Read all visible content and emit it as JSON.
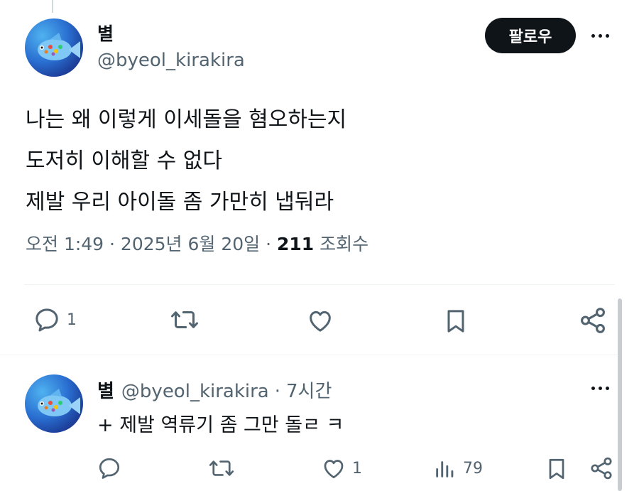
{
  "tweet": {
    "author_name": "별",
    "author_handle": "@byeol_kirakira",
    "follow_label": "팔로우",
    "text_lines": [
      "나는 왜 이렇게 이세돌을 혐오하는지",
      "도저히 이해할 수 없다",
      "제발 우리 아이돌 좀 가만히 냅둬라"
    ],
    "meta": {
      "time_date": "오전 1:49 · 2025년 6월 20일",
      "separator": " · ",
      "views_count": "211",
      "views_label": " 조회수"
    },
    "actions": {
      "reply_count": "1"
    }
  },
  "reply": {
    "author_name": "별",
    "author_handle": "@byeol_kirakira",
    "dot": "·",
    "time": "7시간",
    "text": "+ 제발 역류기 좀 그만 돌ㄹ ㅋ",
    "actions": {
      "like_count": "1",
      "views_count": "79"
    }
  },
  "icons": [
    "more-icon",
    "reply-icon",
    "retweet-icon",
    "like-icon",
    "bookmark-icon",
    "share-icon",
    "views-icon"
  ],
  "colors": {
    "text": "#0f1419",
    "secondary": "#536471",
    "follow_bg": "#0f1419",
    "divider": "#eff3f4"
  }
}
